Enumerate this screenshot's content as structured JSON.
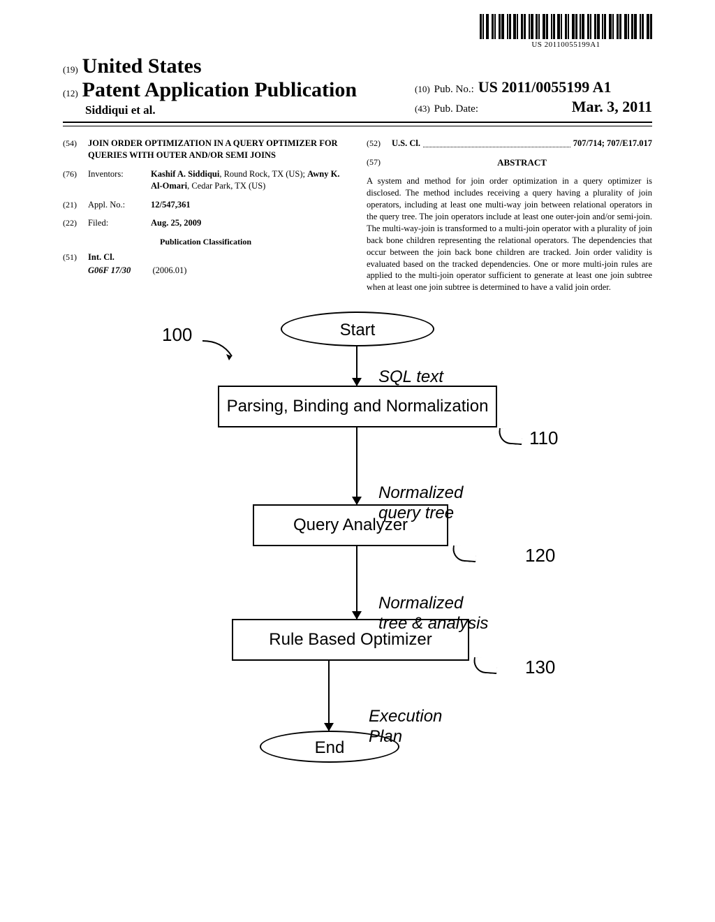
{
  "barcode_text": "US 20110055199A1",
  "header": {
    "code19": "(19)",
    "country": "United States",
    "code12": "(12)",
    "pub_type": "Patent Application Publication",
    "authors_line": "Siddiqui et al.",
    "code10": "(10)",
    "pubno_label": "Pub. No.:",
    "pubno_value": "US 2011/0055199 A1",
    "code43": "(43)",
    "pubdate_label": "Pub. Date:",
    "pubdate_value": "Mar. 3, 2011"
  },
  "left": {
    "code54": "(54)",
    "title": "JOIN ORDER OPTIMIZATION IN A QUERY OPTIMIZER FOR QUERIES WITH OUTER AND/OR SEMI JOINS",
    "code76": "(76)",
    "inventors_label": "Inventors:",
    "inventors_value_1": "Kashif A. Siddiqui",
    "inventors_value_1_loc": ", Round Rock, TX (US); ",
    "inventors_value_2": "Awny K. Al-Omari",
    "inventors_value_2_loc": ", Cedar Park, TX (US)",
    "code21": "(21)",
    "applno_label": "Appl. No.:",
    "applno_value": "12/547,361",
    "code22": "(22)",
    "filed_label": "Filed:",
    "filed_value": "Aug. 25, 2009",
    "pubclass_heading": "Publication Classification",
    "code51": "(51)",
    "intcl_label": "Int. Cl.",
    "intcl_value": "G06F 17/30",
    "intcl_year": "(2006.01)"
  },
  "right": {
    "code52": "(52)",
    "uscl_label": "U.S. Cl.",
    "uscl_value": "707/714; 707/E17.017",
    "code57": "(57)",
    "abstract_title": "ABSTRACT",
    "abstract_text": "A system and method for join order optimization in a query optimizer is disclosed. The method includes receiving a query having a plurality of join operators, including at least one multi-way join between relational operators in the query tree. The join operators include at least one outer-join and/or semi-join. The multi-way-join is transformed to a multi-join operator with a plurality of join back bone children representing the relational operators. The dependencies that occur between the join back bone children are tracked. Join order validity is evaluated based on the tracked dependencies. One or more multi-join rules are applied to the multi-join operator sufficient to generate at least one join subtree when at least one join subtree is determined to have a valid join order."
  },
  "diagram": {
    "ref100": "100",
    "start": "Start",
    "sql_text": "SQL text",
    "box110": "Parsing, Binding and Normalization",
    "ref110": "110",
    "norm_tree": "Normalized\nquery tree",
    "box120": "Query Analyzer",
    "ref120": "120",
    "norm_analysis": "Normalized\ntree & analysis",
    "box130": "Rule Based Optimizer",
    "ref130": "130",
    "exec_plan": "Execution\nPlan",
    "end": "End"
  }
}
